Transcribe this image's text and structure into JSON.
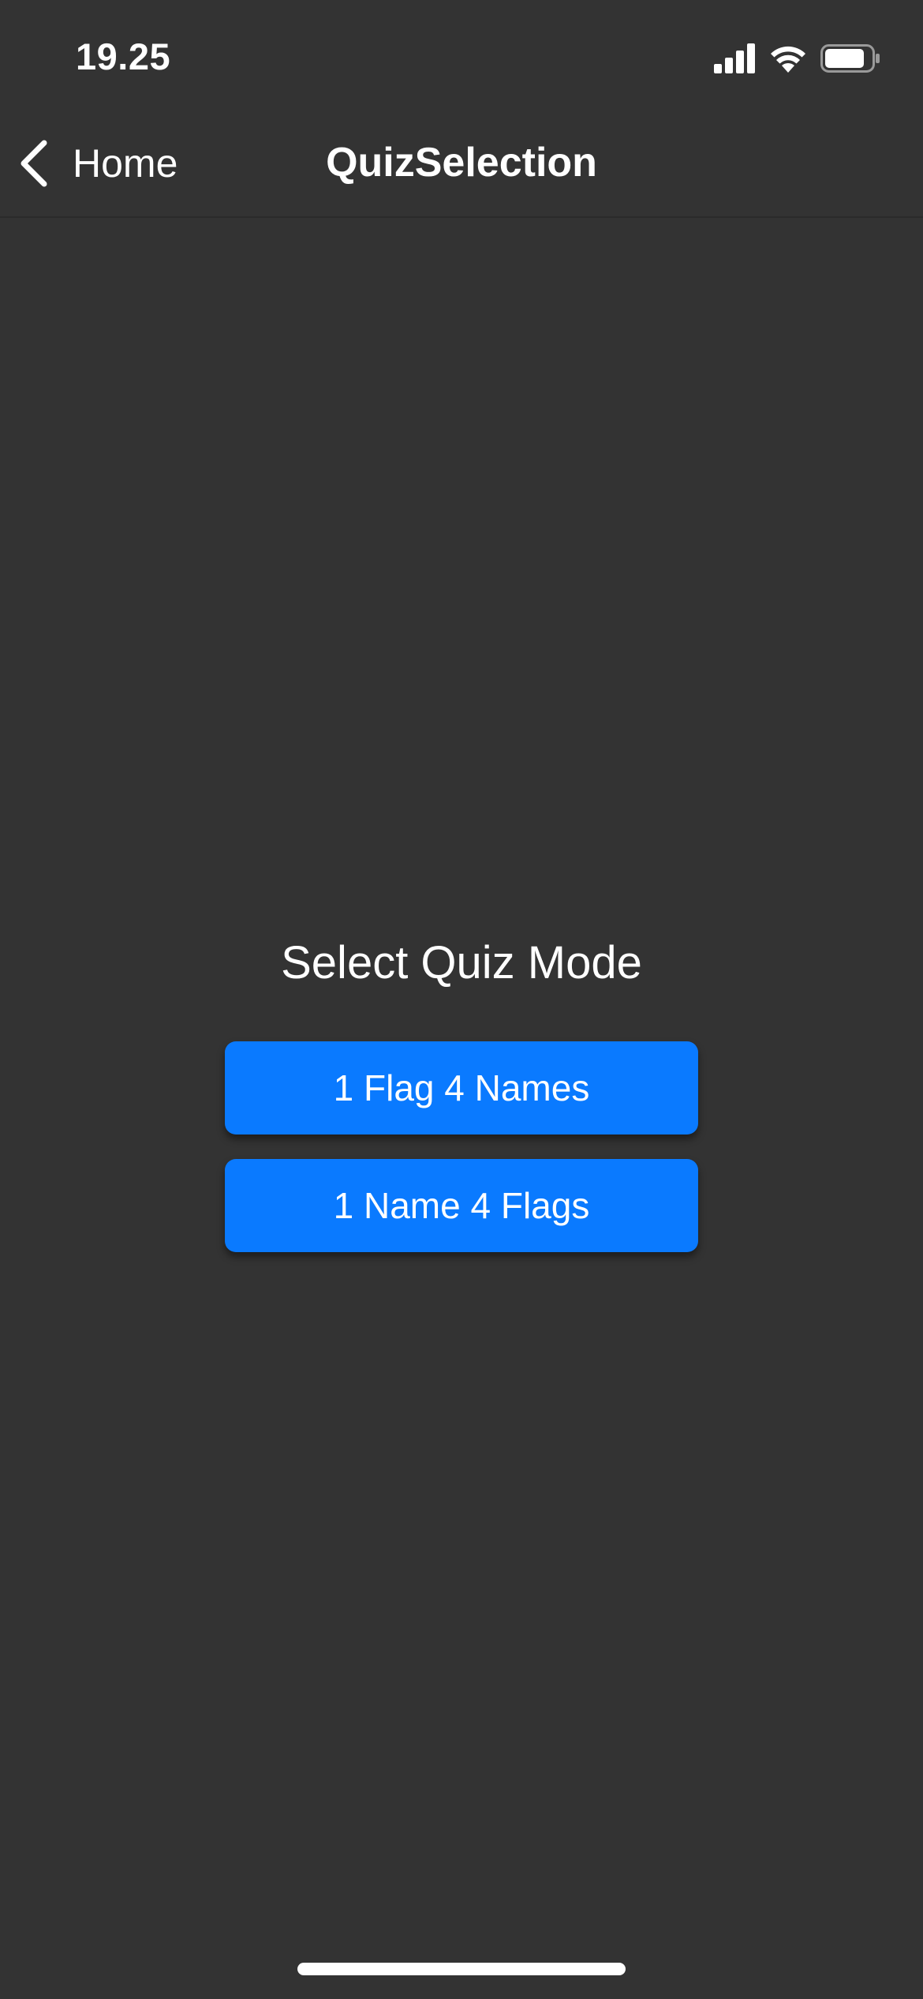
{
  "status_bar": {
    "time": "19.25",
    "icons": [
      "signal-icon",
      "wifi-icon",
      "battery-icon"
    ]
  },
  "nav": {
    "back_label": "Home",
    "title": "QuizSelection"
  },
  "main": {
    "heading": "Select Quiz Mode",
    "buttons": [
      {
        "label": "1 Flag 4 Names"
      },
      {
        "label": "1 Name 4 Flags"
      }
    ]
  },
  "colors": {
    "background": "#333333",
    "accent": "#0a7aff",
    "text": "#ffffff"
  }
}
